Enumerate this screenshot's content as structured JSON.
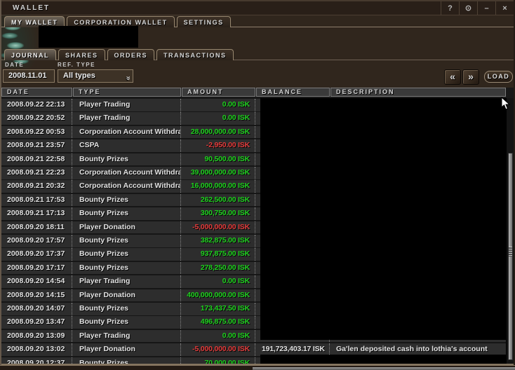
{
  "window": {
    "title": "WALLET",
    "controls": {
      "help": "?",
      "pin": "⊙",
      "minimize": "–",
      "close": "×"
    }
  },
  "main_tabs": [
    {
      "label": "MY WALLET",
      "active": true
    },
    {
      "label": "CORPORATION WALLET",
      "active": false
    },
    {
      "label": "SETTINGS",
      "active": false
    }
  ],
  "sub_tabs": [
    {
      "label": "JOURNAL",
      "active": true
    },
    {
      "label": "SHARES",
      "active": false
    },
    {
      "label": "ORDERS",
      "active": false
    },
    {
      "label": "TRANSACTIONS",
      "active": false
    }
  ],
  "filters": {
    "date_label": "DATE",
    "ref_type_label": "REF. TYPE",
    "date_value": "2008.11.01",
    "ref_type_value": "All types",
    "prev_label": "«",
    "next_label": "»",
    "dropdown_chevron": "»",
    "load_label": "LOAD"
  },
  "table": {
    "columns": [
      "DATE",
      "TYPE",
      "AMOUNT",
      "BALANCE",
      "DESCRIPTION"
    ],
    "rows": [
      {
        "date": "2008.09.22 22:13",
        "type": "Player Trading",
        "amount": "0.00 ISK",
        "balance": "",
        "description": ""
      },
      {
        "date": "2008.09.22 20:52",
        "type": "Player Trading",
        "amount": "0.00 ISK",
        "balance": "",
        "description": ""
      },
      {
        "date": "2008.09.22 00:53",
        "type": "Corporation Account Withdrawal",
        "amount": "28,000,000.00 ISK",
        "balance": "",
        "description": ""
      },
      {
        "date": "2008.09.21 23:57",
        "type": "CSPA",
        "amount": "-2,950.00 ISK",
        "balance": "",
        "description": ""
      },
      {
        "date": "2008.09.21 22:58",
        "type": "Bounty Prizes",
        "amount": "90,500.00 ISK",
        "balance": "",
        "description": ""
      },
      {
        "date": "2008.09.21 22:23",
        "type": "Corporation Account Withdrawal",
        "amount": "39,000,000.00 ISK",
        "balance": "",
        "description": ""
      },
      {
        "date": "2008.09.21 20:32",
        "type": "Corporation Account Withdrawal",
        "amount": "16,000,000.00 ISK",
        "balance": "",
        "description": ""
      },
      {
        "date": "2008.09.21 17:53",
        "type": "Bounty Prizes",
        "amount": "262,500.00 ISK",
        "balance": "",
        "description": ""
      },
      {
        "date": "2008.09.21 17:13",
        "type": "Bounty Prizes",
        "amount": "300,750.00 ISK",
        "balance": "",
        "description": ""
      },
      {
        "date": "2008.09.20 18:11",
        "type": "Player Donation",
        "amount": "-5,000,000.00 ISK",
        "balance": "",
        "description": ""
      },
      {
        "date": "2008.09.20 17:57",
        "type": "Bounty Prizes",
        "amount": "382,875.00 ISK",
        "balance": "",
        "description": ""
      },
      {
        "date": "2008.09.20 17:37",
        "type": "Bounty Prizes",
        "amount": "937,875.00 ISK",
        "balance": "",
        "description": ""
      },
      {
        "date": "2008.09.20 17:17",
        "type": "Bounty Prizes",
        "amount": "278,250.00 ISK",
        "balance": "",
        "description": ""
      },
      {
        "date": "2008.09.20 14:54",
        "type": "Player Trading",
        "amount": "0.00 ISK",
        "balance": "",
        "description": ""
      },
      {
        "date": "2008.09.20 14:15",
        "type": "Player Donation",
        "amount": "400,000,000.00 ISK",
        "balance": "",
        "description": ""
      },
      {
        "date": "2008.09.20 14:07",
        "type": "Bounty Prizes",
        "amount": "173,437.50 ISK",
        "balance": "",
        "description": ""
      },
      {
        "date": "2008.09.20 13:47",
        "type": "Bounty Prizes",
        "amount": "496,875.00 ISK",
        "balance": "",
        "description": ""
      },
      {
        "date": "2008.09.20 13:09",
        "type": "Player Trading",
        "amount": "0.00 ISK",
        "balance": "",
        "description": ""
      },
      {
        "date": "2008.09.20 13:02",
        "type": "Player Donation",
        "amount": "-5,000,000.00 ISK",
        "balance": "191,723,403.17 ISK",
        "description": "Ga'len deposited cash into lothia's account"
      },
      {
        "date": "2008.09.20 12:37",
        "type": "Bounty Prizes",
        "amount": "70,000.00 ISK",
        "balance": "",
        "description": ""
      }
    ]
  },
  "colors": {
    "positive_amount": "#1fd11f",
    "negative_amount": "#e23b3b",
    "window_background": "#30261d",
    "row_background": "#2d2d2d",
    "header_background": "#3a3a3a",
    "accent_border": "#97876f"
  }
}
